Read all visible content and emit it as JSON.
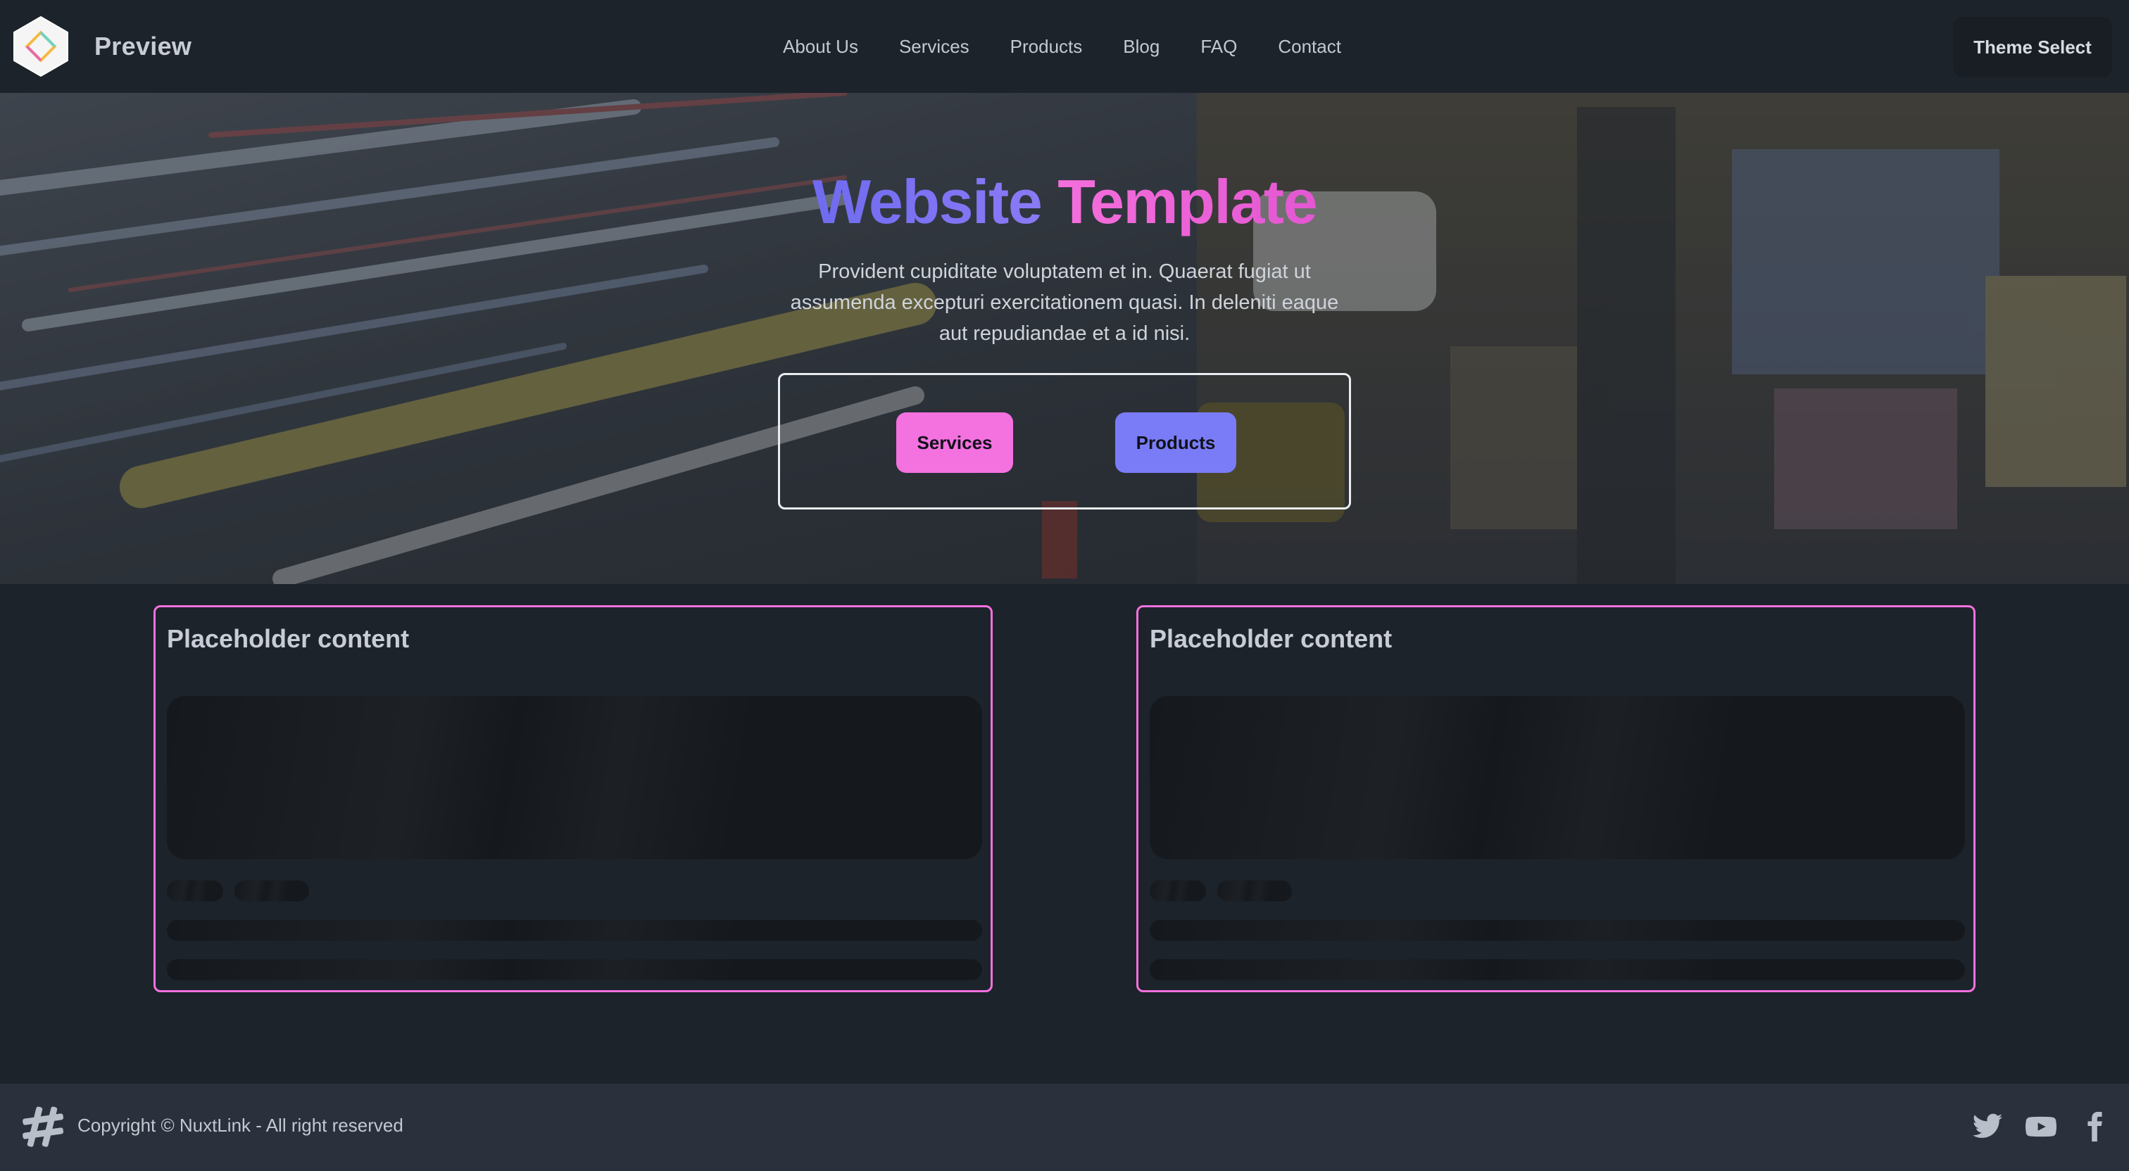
{
  "navbar": {
    "brand": "Preview",
    "links": [
      "About Us",
      "Services",
      "Products",
      "Blog",
      "FAQ",
      "Contact"
    ],
    "theme_button": "Theme Select"
  },
  "hero": {
    "title_part1": "Website",
    "title_part2": "Template",
    "subtitle": "Provident cupiditate voluptatem et in. Quaerat fugiat ut assumenda excepturi exercitationem quasi. In deleniti eaque aut repudiandae et a id nisi.",
    "buttons": {
      "services": "Services",
      "products": "Products"
    }
  },
  "cards": [
    {
      "title": "Placeholder content"
    },
    {
      "title": "Placeholder content"
    }
  ],
  "footer": {
    "copyright": "Copyright © NuxtLink - All right reserved",
    "socials": [
      "twitter-icon",
      "youtube-icon",
      "facebook-icon"
    ]
  },
  "colors": {
    "accent_pink": "#f471e0",
    "accent_indigo": "#7a7cf7",
    "base_bg": "#1d232a",
    "footer_bg": "#2a303c"
  }
}
